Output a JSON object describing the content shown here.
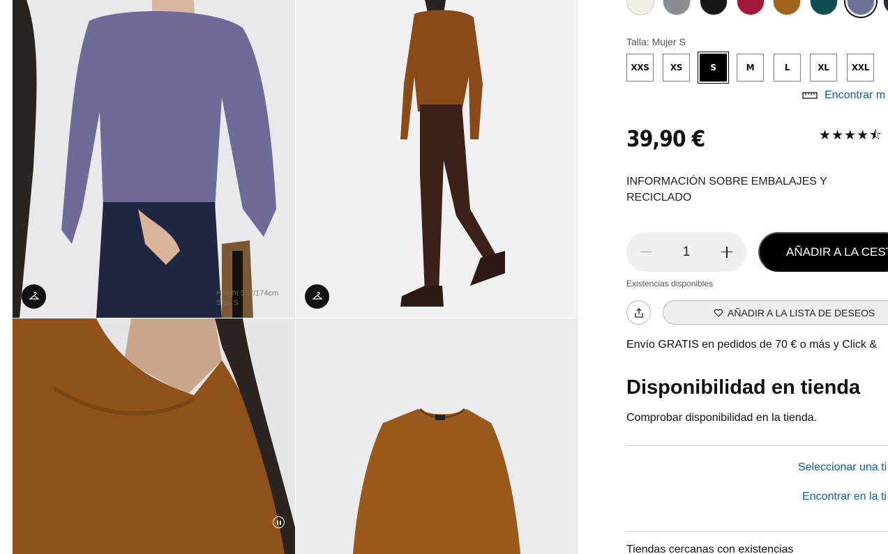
{
  "colors": {
    "swatches": [
      "#f2efe6",
      "#8a8d93",
      "#161616",
      "#a2173a",
      "#a0621c",
      "#0e4d52",
      "#6f7197",
      "#2b2b36"
    ],
    "selected_swatch_index": 6,
    "link": "#0b5fb0"
  },
  "gallery": {
    "model_info_line1": "Height 5'9\"/174cm",
    "model_info_line2": "Size S",
    "hanger_icon": "hanger-icon",
    "pause_icon": "pause-icon"
  },
  "size": {
    "label": "Talla: Mujer S",
    "options": [
      "XXS",
      "XS",
      "S",
      "M",
      "L",
      "XL",
      "XXL"
    ],
    "selected": "S",
    "find_size_link": "Encontrar m"
  },
  "price": "39,90 €",
  "rating_stars": "★★★★⯪",
  "packaging_info": "INFORMACIÓN SOBRE EMBALAJES Y RECICLADO",
  "quantity": {
    "value": "1"
  },
  "add_to_cart_label": "AÑADIR A LA CESTA",
  "stock_status": "Existencias disponibles",
  "wishlist_label": "AÑADIR A LA LISTA DE DESEOS",
  "shipping_text": "Envío GRATIS en pedidos de 70 € o más y Click &",
  "store_availability": {
    "title": "Disponibilidad en tienda",
    "description": "Comprobar disponibilidad en la tienda.",
    "select_store_link": "Seleccionar una ti",
    "find_store_link": "Encontrar en la ti",
    "nearby_stores": "Tiendas cercanas con existencias"
  }
}
